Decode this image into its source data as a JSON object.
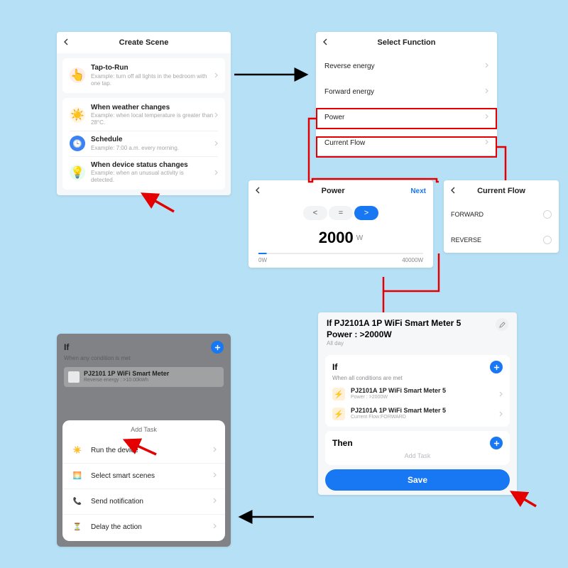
{
  "panel1": {
    "title": "Create Scene",
    "items": [
      {
        "title": "Tap-to-Run",
        "sub": "Example: turn off all lights in the bedroom with one tap."
      },
      {
        "title": "When weather changes",
        "sub": "Example: when local temperature is greater than 28°C."
      },
      {
        "title": "Schedule",
        "sub": "Example: 7:00 a.m. every morning."
      },
      {
        "title": "When device status changes",
        "sub": "Example: when an unusual activity is detected."
      }
    ]
  },
  "panel2": {
    "title": "Select Function",
    "items": [
      "Reverse energy",
      "Forward energy",
      "Power",
      "Current Flow"
    ]
  },
  "panel3": {
    "title": "Power",
    "next": "Next",
    "ops": {
      "lt": "<",
      "eq": "=",
      "gt": ">"
    },
    "value": "2000",
    "unit": "W",
    "min": "0W",
    "max": "40000W"
  },
  "panel4": {
    "title": "Current Flow",
    "opts": [
      "FORWARD",
      "REVERSE"
    ]
  },
  "panel5": {
    "title": "If PJ2101A 1P WiFi Smart Meter  5 Power : >2000W",
    "allday": "All day",
    "if": {
      "label": "If",
      "sub": "When all conditions are met"
    },
    "conds": [
      {
        "name": "PJ2101A 1P WiFi Smart Meter 5",
        "detail": "Power : >2000W"
      },
      {
        "name": "PJ2101A 1P WiFi Smart Meter 5",
        "detail": "Current Flow:FORWARD"
      }
    ],
    "then": "Then",
    "addtask": "Add Task",
    "save": "Save"
  },
  "panel6": {
    "if": "If",
    "ifsub": "When any condition is met",
    "dev": {
      "name": "PJ2101 1P WiFi Smart Meter",
      "detail": "Reverse energy : >10.00kWh"
    },
    "sheet_title": "Add Task",
    "tasks": [
      "Run the device",
      "Select smart scenes",
      "Send notification",
      "Delay the action"
    ]
  }
}
